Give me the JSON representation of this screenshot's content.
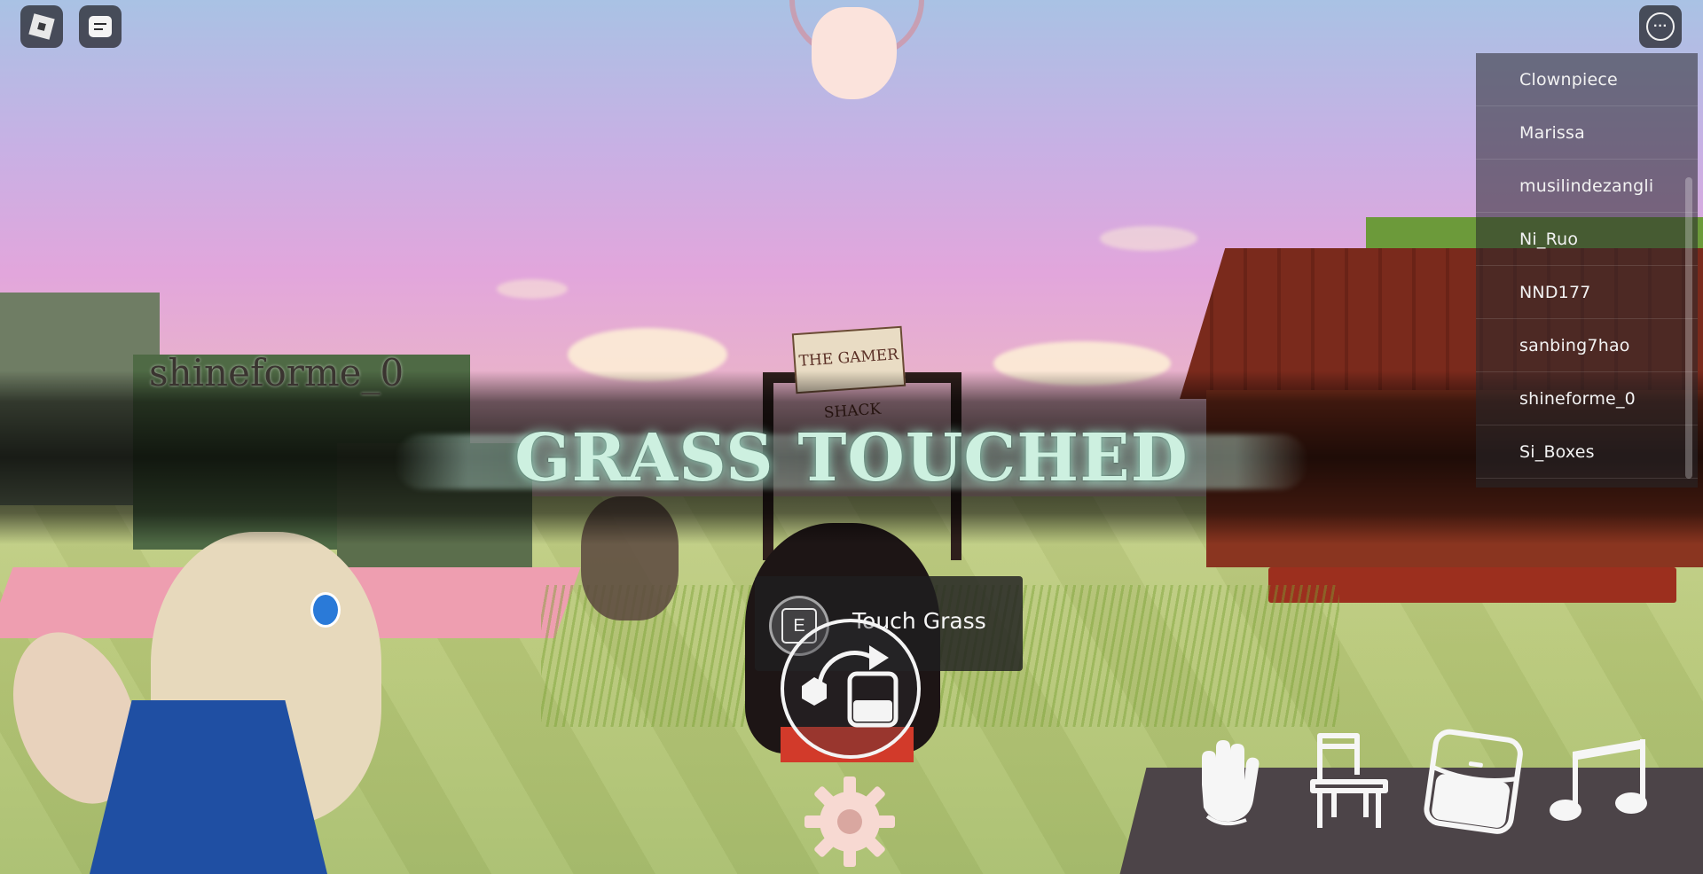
{
  "top_bar": {
    "roblox_menu_icon": "roblox-logo-icon",
    "chat_icon": "chat-icon",
    "more_icon": "more-options-icon",
    "more_glyph": "···"
  },
  "world": {
    "sign_text": "THE GAMER SHACK",
    "player_nametag": "shineforme_0"
  },
  "banner": {
    "title": "GRASS TOUCHED"
  },
  "player_list": {
    "players": [
      "Clownpiece",
      "Marissa",
      "musilindezangli",
      "Ni_Ruo",
      "NND177",
      "sanbing7hao",
      "shineforme_0",
      "Si_Boxes"
    ]
  },
  "prompt": {
    "key": "E",
    "action": "Touch Grass"
  },
  "toolbar": {
    "icons": [
      "wave-hand-icon",
      "chair-icon",
      "backpack-icon",
      "music-note-icon"
    ],
    "center_icons": [
      "swap-icon",
      "gear-icon"
    ]
  },
  "colors": {
    "banner_text": "#cdf0e0",
    "panel_bg": "#28282c",
    "icon_white": "#f4f4f4"
  }
}
